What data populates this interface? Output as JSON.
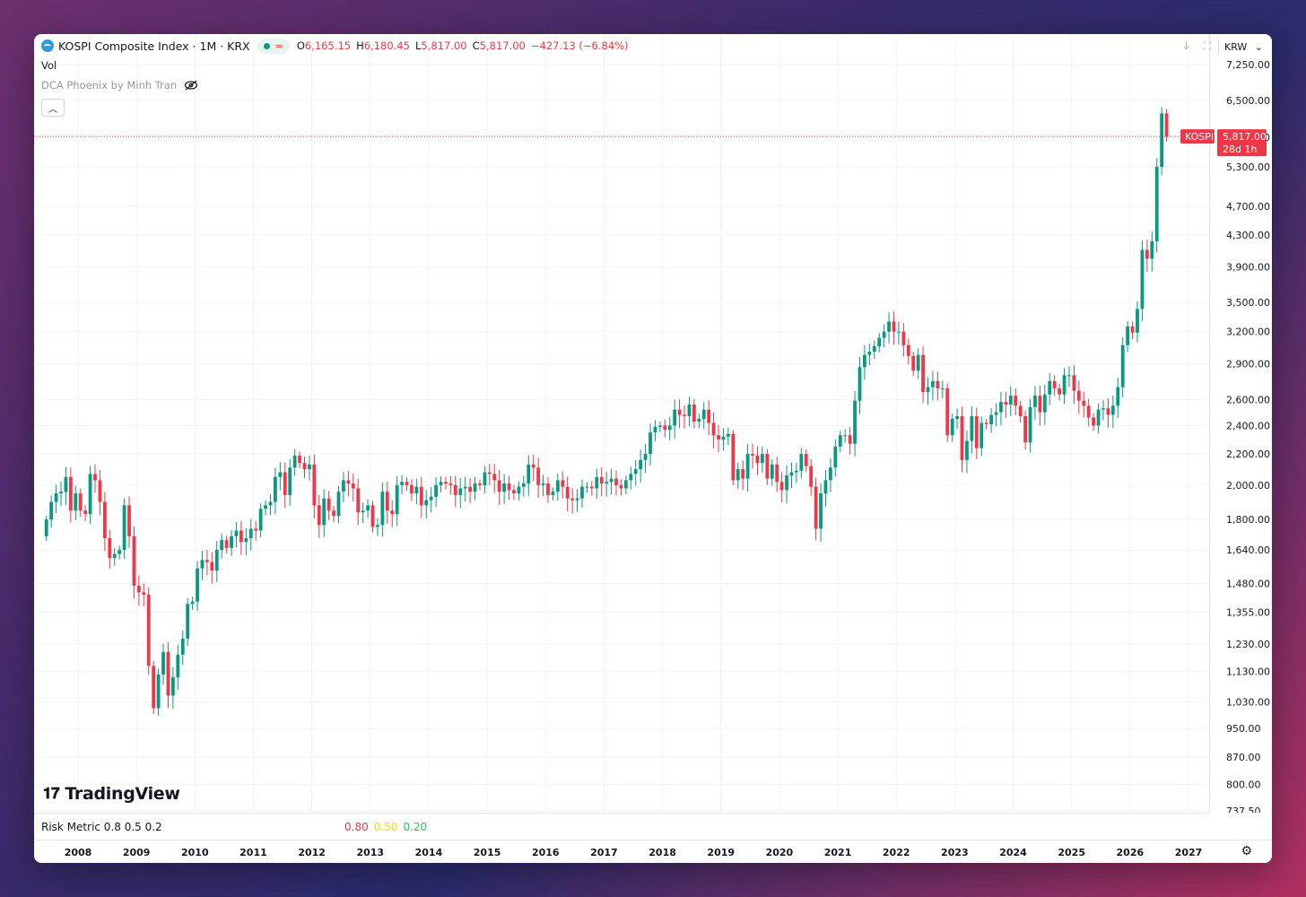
{
  "header": {
    "symbol_title": "KOSPI Composite Index · 1M · KRX",
    "open_label": "O",
    "open": "6,165.15",
    "high_label": "H",
    "high": "6,180.45",
    "low_label": "L",
    "low": "5,817.00",
    "close_label": "C",
    "close": "5,817.00",
    "change": "−427.13 (−6.84%)",
    "currency": "KRW"
  },
  "volume_label": "Vol",
  "indicator_label": "DCA Phoenix by Minh Tran",
  "watermark": "TradingView",
  "risk_metric": {
    "label": "Risk Metric 0.8 0.5 0.2",
    "v1": "0.80",
    "v2": "0.50",
    "v3": "0.20",
    "colors": [
      "#f23645",
      "#f5d90a",
      "#22c55e"
    ]
  },
  "price_tag": {
    "symbol": "KOSPI",
    "price": "5,817.00",
    "countdown": "28d 1h"
  },
  "colors": {
    "up": "#089981",
    "down": "#f23645"
  },
  "chart_data": {
    "type": "candlestick",
    "y_scale": "log",
    "ylim": [
      737.5,
      7250
    ],
    "y_ticks": [
      "7,250.00",
      "6,500.00",
      "5,800.00",
      "5,300.00",
      "4,700.00",
      "4,300.00",
      "3,900.00",
      "3,500.00",
      "3,200.00",
      "2,900.00",
      "2,600.00",
      "2,400.00",
      "2,200.00",
      "2,000.00",
      "1,800.00",
      "1,640.00",
      "1,480.00",
      "1,355.00",
      "1,230.00",
      "1,130.00",
      "1,030.00",
      "950.00",
      "870.00",
      "800.00",
      "737.50"
    ],
    "x_ticks": [
      "2008",
      "2009",
      "2010",
      "2011",
      "2012",
      "2013",
      "2014",
      "2015",
      "2016",
      "2017",
      "2018",
      "2019",
      "2020",
      "2021",
      "2022",
      "2023",
      "2024",
      "2025",
      "2026",
      "2027"
    ],
    "last_price": 5817,
    "monthly_close": [
      1800,
      1900,
      1950,
      1960,
      2050,
      1850,
      1950,
      1850,
      1830,
      2070,
      2030,
      1900,
      1700,
      1600,
      1620,
      1640,
      1880,
      1710,
      1470,
      1440,
      1430,
      1150,
      1010,
      1120,
      1200,
      1050,
      1110,
      1190,
      1250,
      1390,
      1400,
      1550,
      1590,
      1580,
      1540,
      1640,
      1690,
      1650,
      1710,
      1740,
      1680,
      1700,
      1750,
      1740,
      1860,
      1880,
      1900,
      2050,
      2080,
      1940,
      2110,
      2190,
      2140,
      2100,
      2130,
      1880,
      1770,
      1920,
      1850,
      1820,
      1960,
      2030,
      2010,
      1980,
      1840,
      1850,
      1880,
      1760,
      1770,
      1960,
      1850,
      1830,
      2000,
      2020,
      2000,
      1950,
      1990,
      1880,
      1910,
      1930,
      2000,
      2020,
      2010,
      2000,
      1940,
      1980,
      1990,
      1960,
      2010,
      2000,
      2080,
      2070,
      2030,
      1960,
      2010,
      1970,
      1950,
      1990,
      2010,
      2130,
      2110,
      2000,
      2010,
      1940,
      1960,
      2030,
      1990,
      1920,
      1910,
      1920,
      1990,
      1990,
      1980,
      2050,
      2010,
      2020,
      2040,
      2000,
      1980,
      2030,
      2070,
      2100,
      2160,
      2200,
      2350,
      2390,
      2400,
      2370,
      2400,
      2520,
      2480,
      2470,
      2560,
      2430,
      2450,
      2520,
      2420,
      2330,
      2300,
      2320,
      2340,
      2030,
      2100,
      2040,
      2200,
      2190,
      2140,
      2200,
      2040,
      2130,
      2020,
      1970,
      2060,
      2080,
      2090,
      2200,
      2120,
      1990,
      1750,
      1950,
      2030,
      2110,
      2250,
      2330,
      2330,
      2270,
      2590,
      2870,
      2980,
      3010,
      3060,
      3140,
      3200,
      3300,
      3200,
      3200,
      3070,
      2970,
      2840,
      2980,
      2660,
      2700,
      2750,
      2690,
      2690,
      2330,
      2450,
      2470,
      2160,
      2290,
      2470,
      2240,
      2420,
      2410,
      2480,
      2500,
      2580,
      2560,
      2630,
      2550,
      2470,
      2280,
      2540,
      2630,
      2500,
      2640,
      2750,
      2690,
      2640,
      2800,
      2800,
      2670,
      2590,
      2550,
      2460,
      2400,
      2520,
      2530,
      2480,
      2550,
      2700,
      3070,
      3250,
      3190,
      3430,
      4110,
      4000,
      4220,
      5300,
      6244,
      5817
    ]
  }
}
